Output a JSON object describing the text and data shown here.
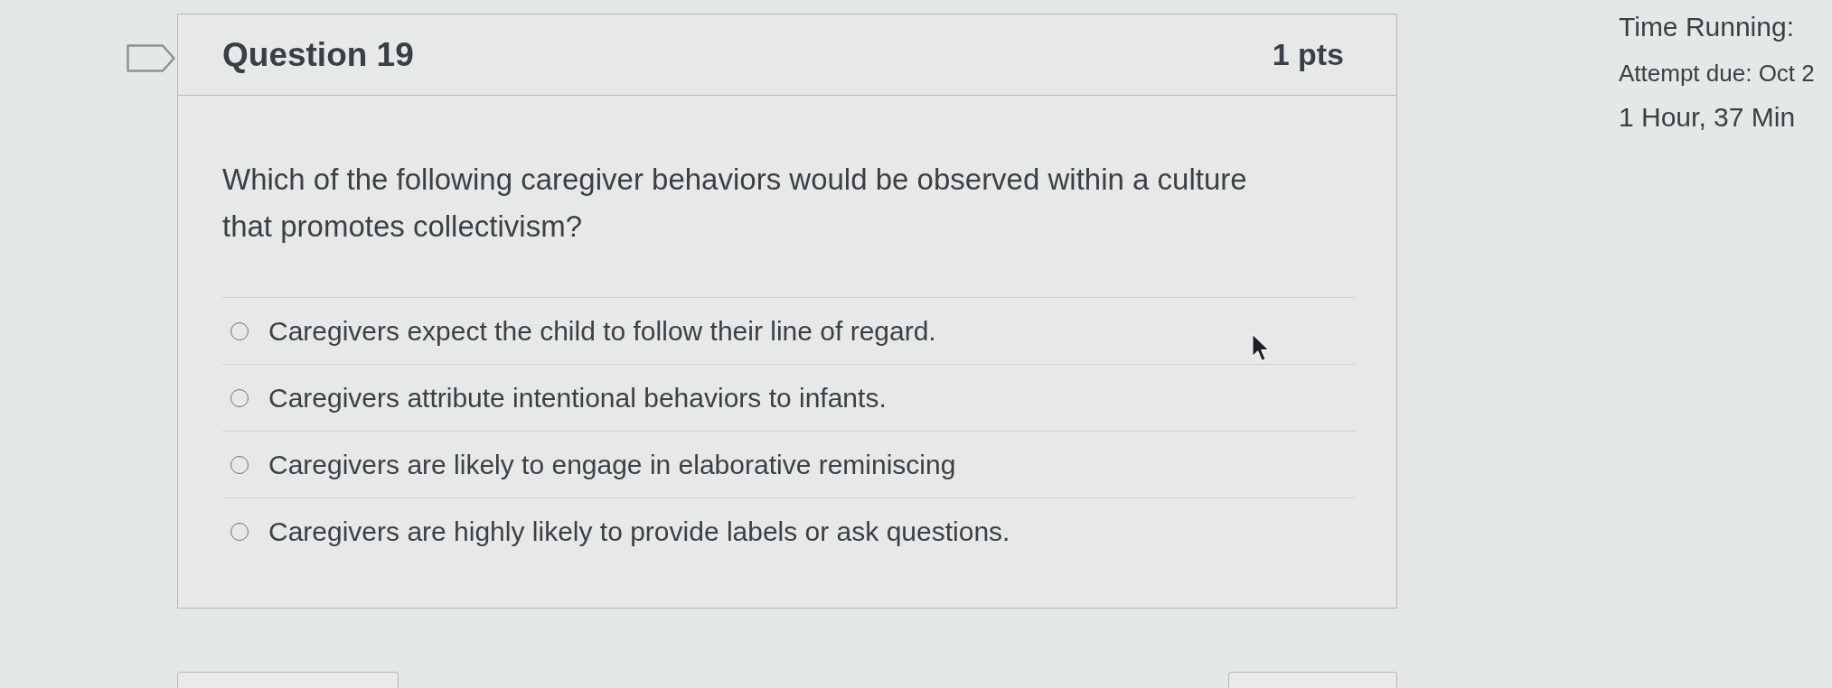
{
  "question": {
    "flagged": false,
    "title": "Question 19",
    "points": "1 pts",
    "text": "Which of the following caregiver behaviors would be observed within a culture that promotes collectivism?",
    "answers": [
      {
        "label": "Caregivers expect the child to follow their line of regard.",
        "selected": false
      },
      {
        "label": "Caregivers attribute intentional behaviors to infants.",
        "selected": false
      },
      {
        "label": "Caregivers are likely to engage in elaborative reminiscing",
        "selected": false
      },
      {
        "label": "Caregivers are highly likely to provide labels or ask questions.",
        "selected": false
      }
    ]
  },
  "sidebar": {
    "timer_label": "Time Running:",
    "attempt_due": "Attempt due: Oct 2",
    "elapsed": "1 Hour, 37 Min"
  }
}
